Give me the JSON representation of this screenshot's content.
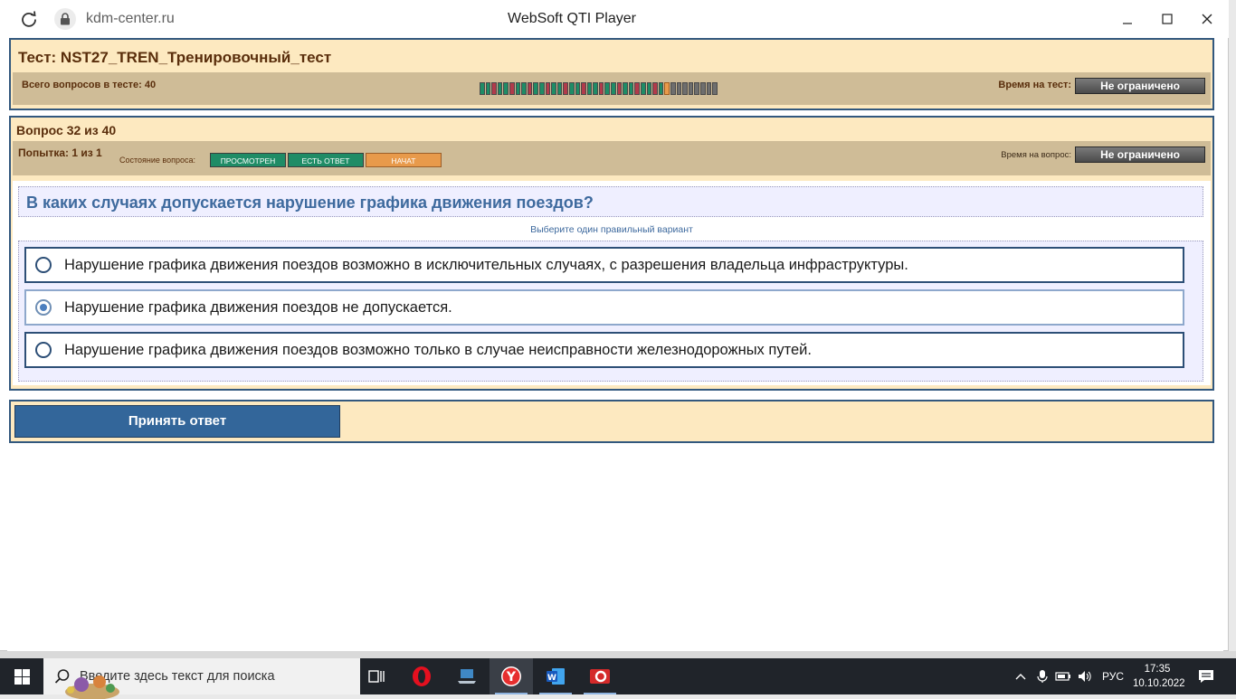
{
  "window": {
    "url": "kdm-center.ru",
    "title": "WebSoft QTI Player"
  },
  "test": {
    "title": "Тест: NST27_TREN_Тренировочный_тест",
    "total_label": "Всего вопросов в тесте: 40",
    "time_label": "Время на тест:",
    "time_value": "Не ограничено",
    "progress": {
      "total": 40,
      "answered": 31,
      "current": 32
    }
  },
  "question": {
    "number_label": "Вопрос 32 из 40",
    "attempt_label": "Попытка: 1 из 1",
    "state_label": "Состояние вопроса:",
    "states": [
      "ПРОСМОТРЕН",
      "ЕСТЬ ОТВЕТ",
      "НАЧАТ"
    ],
    "time_label": "Время на вопрос:",
    "time_value": "Не ограничено",
    "text": "В каких случаях допускается нарушение графика движения поездов?",
    "hint": "Выберите один правильный вариант",
    "answers": [
      {
        "text": "Нарушение графика движения поездов возможно в исключительных случаях, с разрешения владельца инфраструктуры.",
        "selected": false
      },
      {
        "text": "Нарушение графика движения поездов не допускается.",
        "selected": true
      },
      {
        "text": "Нарушение графика движения поездов возможно только в случае неисправности железнодорожных путей.",
        "selected": false
      }
    ]
  },
  "submit_label": "Принять ответ",
  "taskbar": {
    "search_placeholder": "Введите здесь текст для поиска",
    "apps": [
      "task-view-icon",
      "opera-icon",
      "laptop-app-icon",
      "yandex-browser-icon",
      "word-icon",
      "red-app-icon"
    ],
    "language": "РУС",
    "time": "17:35",
    "date": "10.10.2022"
  }
}
